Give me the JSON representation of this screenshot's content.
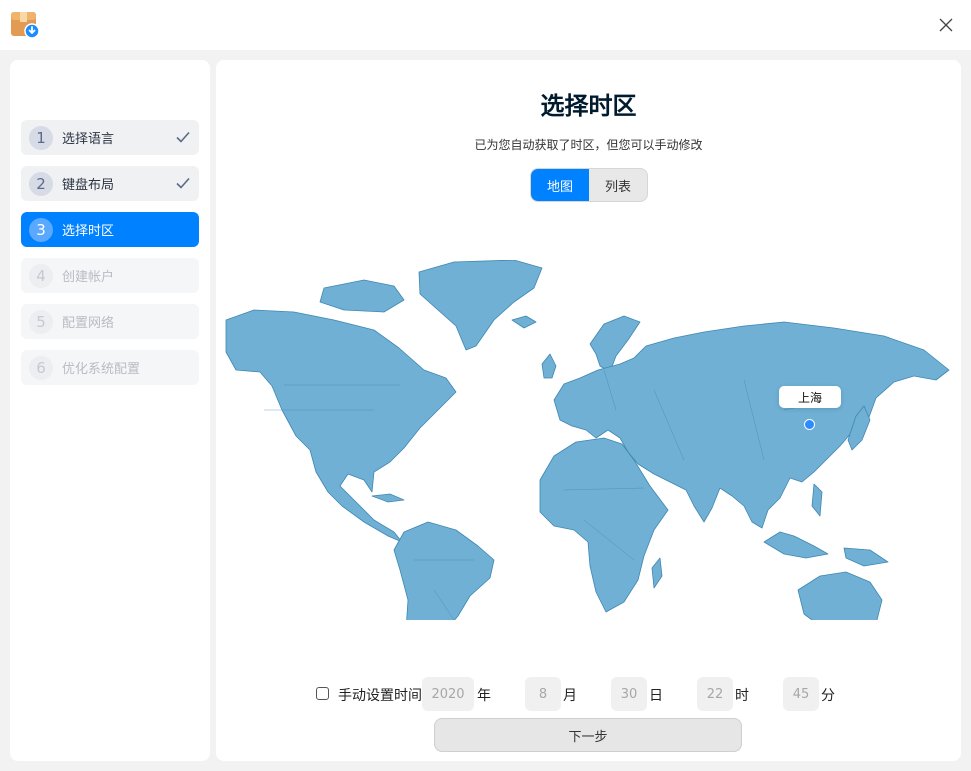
{
  "sidebar": {
    "steps": [
      {
        "num": "1",
        "label": "选择语言",
        "state": "done"
      },
      {
        "num": "2",
        "label": "键盘布局",
        "state": "done"
      },
      {
        "num": "3",
        "label": "选择时区",
        "state": "active"
      },
      {
        "num": "4",
        "label": "创建帐户",
        "state": "disabled"
      },
      {
        "num": "5",
        "label": "配置网络",
        "state": "disabled"
      },
      {
        "num": "6",
        "label": "优化系统配置",
        "state": "disabled"
      }
    ]
  },
  "main": {
    "title": "选择时区",
    "subtitle": "已为您自动获取了时区，但您可以手动修改",
    "view_tabs": {
      "map": "地图",
      "list": "列表",
      "selected": "map"
    },
    "map": {
      "selected_city": "上海"
    },
    "manual_time": {
      "label": "手动设置时间",
      "checked": false,
      "year": "2020",
      "year_unit": "年",
      "month": "8",
      "month_unit": "月",
      "day": "30",
      "day_unit": "日",
      "hour": "22",
      "hour_unit": "时",
      "minute": "45",
      "minute_unit": "分"
    },
    "next_label": "下一步"
  },
  "colors": {
    "accent": "#0081ff",
    "map_land": "#6fb0d4",
    "map_border": "#3e87b3"
  },
  "icons": {
    "app": "installer-box-icon",
    "close": "close-icon",
    "check": "checkmark-icon"
  }
}
